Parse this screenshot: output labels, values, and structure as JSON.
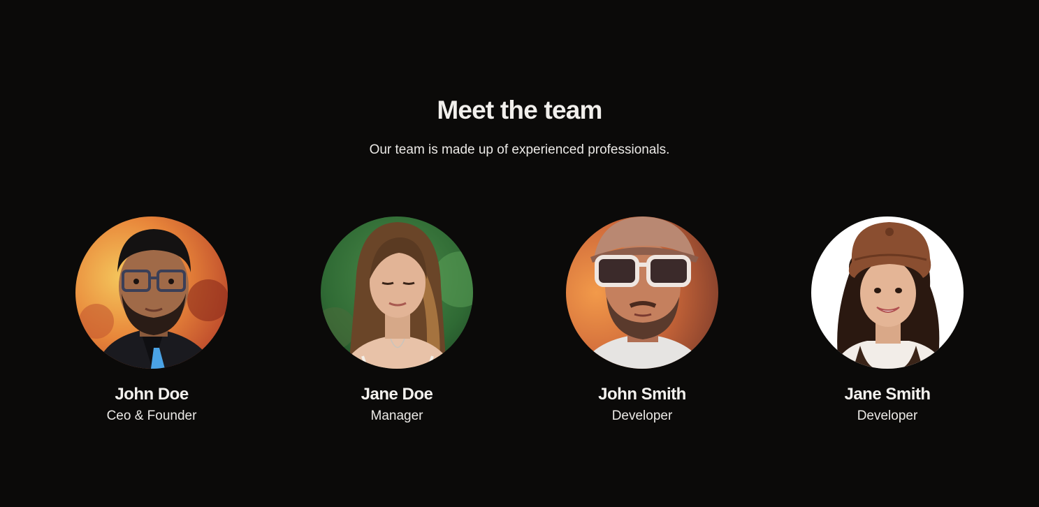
{
  "header": {
    "title": "Meet the team",
    "subtitle": "Our team is made up of experienced professionals."
  },
  "team": [
    {
      "name": "John Doe",
      "role": "Ceo & Founder",
      "photo": "man-glasses-photo"
    },
    {
      "name": "Jane Doe",
      "role": "Manager",
      "photo": "woman-long-hair-photo"
    },
    {
      "name": "John Smith",
      "role": "Developer",
      "photo": "man-sunglasses-cap-photo"
    },
    {
      "name": "Jane Smith",
      "role": "Developer",
      "photo": "woman-brown-hat-photo"
    }
  ],
  "colors": {
    "background": "#0b0a09",
    "text": "#f3f1ee"
  }
}
